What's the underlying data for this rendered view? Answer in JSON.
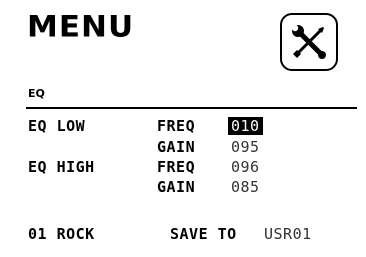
{
  "header": {
    "title": "MENU",
    "tool_icon": "wrench-screwdriver-icon"
  },
  "section": {
    "label": "EQ"
  },
  "eq_low": {
    "label": "EQ LOW",
    "freq_label": "FREQ",
    "freq_value": "010",
    "gain_label": "GAIN",
    "gain_value": "095"
  },
  "eq_high": {
    "label": "EQ HIGH",
    "freq_label": "FREQ",
    "freq_value": "096",
    "gain_label": "GAIN",
    "gain_value": "085"
  },
  "footer": {
    "preset": "01 ROCK",
    "save_label": "SAVE TO",
    "save_target": "USR01"
  },
  "colors": {
    "foreground": "#000000",
    "background": "#ffffff",
    "selection": "#000000"
  }
}
